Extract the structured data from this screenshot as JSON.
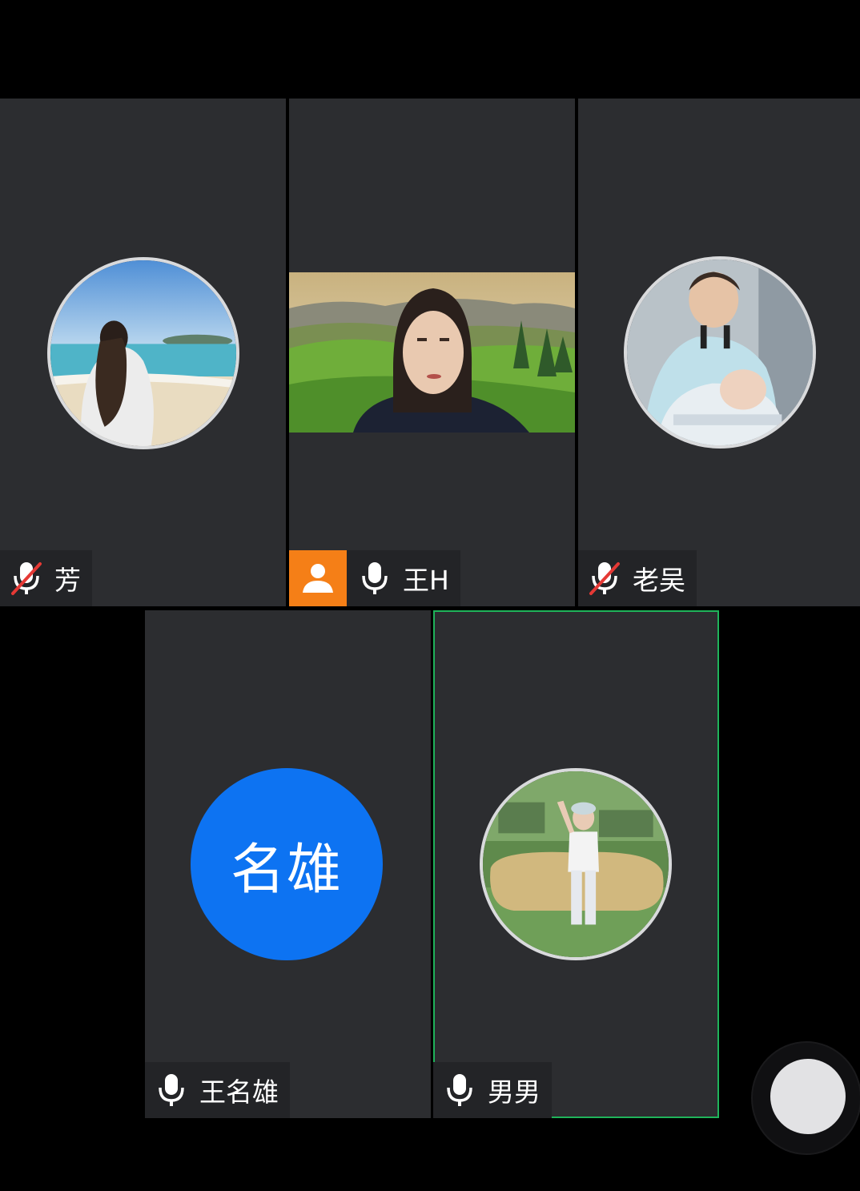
{
  "participants": [
    {
      "name": "芳",
      "mic": "muted",
      "avatar": "beach-photo"
    },
    {
      "name": "王H",
      "mic": "on",
      "host": true,
      "video": "camera-feed-landscape-background"
    },
    {
      "name": "老吴",
      "mic": "muted",
      "avatar": "children-photo"
    },
    {
      "name": "王名雄",
      "mic": "on",
      "initials": "名雄",
      "avatar_color": "#0d73f2"
    },
    {
      "name": "男男",
      "mic": "on",
      "avatar": "garden-photo",
      "speaking": true
    }
  ],
  "icons": {
    "mic_on": "microphone-icon",
    "mic_muted": "microphone-muted-icon",
    "host": "host-person-icon"
  },
  "colors": {
    "tile_background": "#2c2d30",
    "label_background": "#232427",
    "active_speaker_border": "#1fb35a",
    "host_badge": "#f57f17",
    "muted_slash": "#e53935"
  }
}
